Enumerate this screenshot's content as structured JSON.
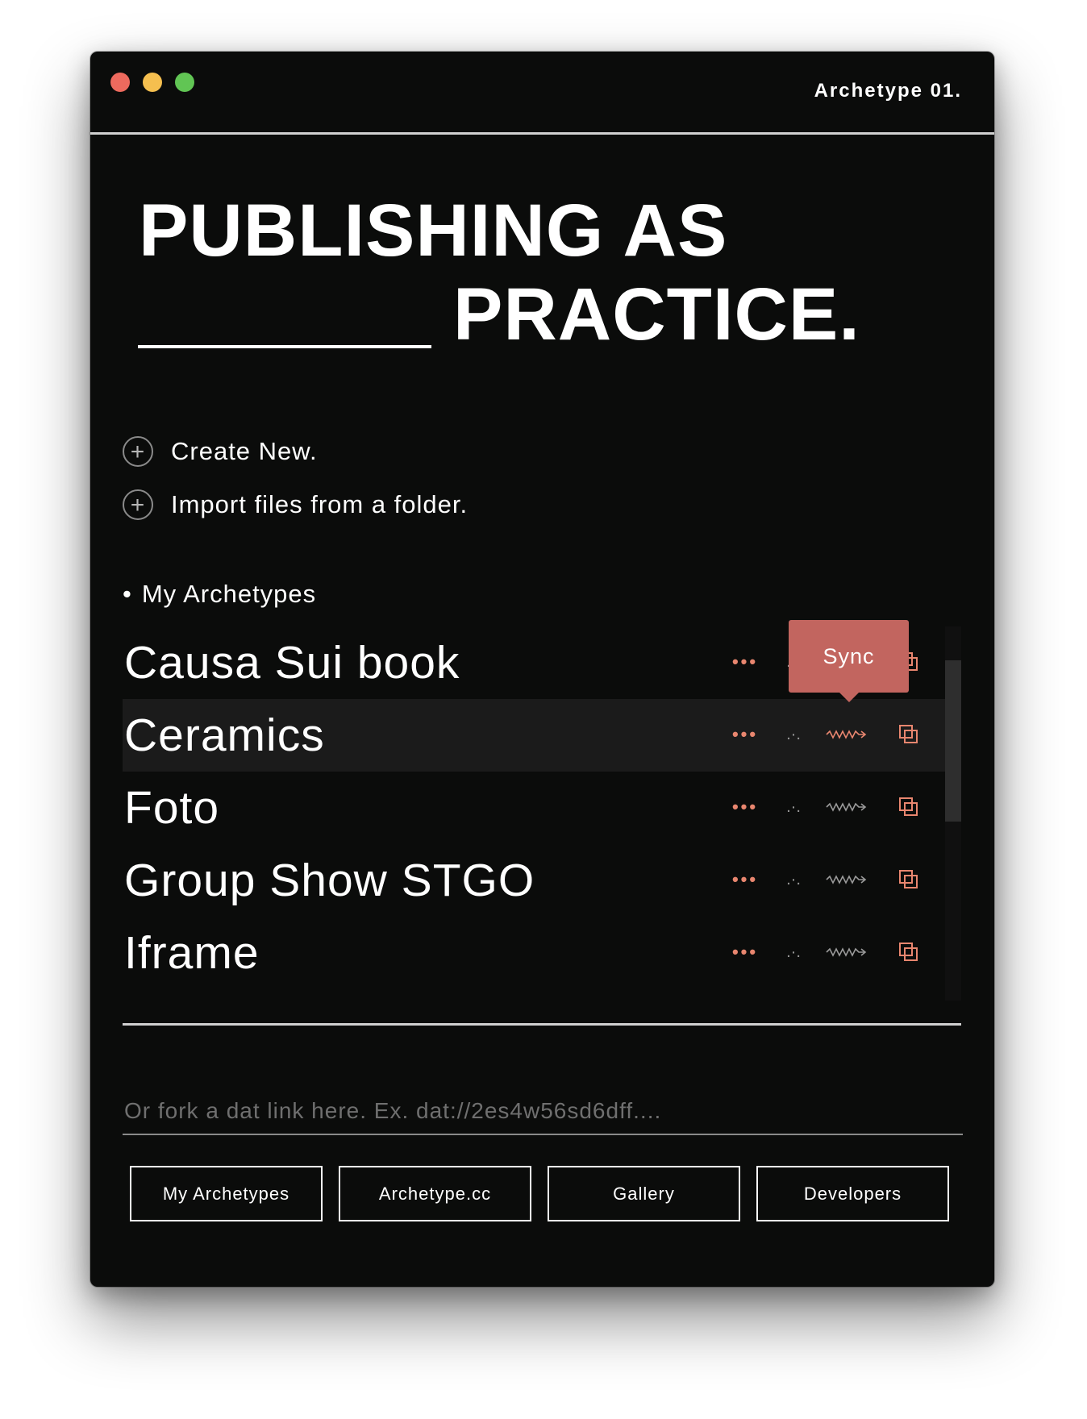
{
  "window": {
    "title": "Archetype 01."
  },
  "headline": {
    "line1": "PUBLISHING AS",
    "line2": "PRACTICE."
  },
  "actions": [
    {
      "label": "Create New."
    },
    {
      "label": "Import files from a folder."
    }
  ],
  "section": {
    "bullet": "•",
    "label": "My Archetypes"
  },
  "archetypes": [
    {
      "name": "Causa Sui book"
    },
    {
      "name": "Ceramics"
    },
    {
      "name": "Foto"
    },
    {
      "name": "Group Show STGO"
    },
    {
      "name": "Iframe"
    }
  ],
  "row_icons": {
    "menu": "ellipsis-icon",
    "peers": "peers-icon",
    "sync": "sync-wave-arrow-icon",
    "fork": "copy-icon",
    "menu_glyph": "•••",
    "peers_glyph": ".·."
  },
  "tooltip": {
    "label": "Sync",
    "active_row": 1
  },
  "fork": {
    "placeholder": "Or fork a dat link here. Ex. dat://2es4w56sd6dff...."
  },
  "footer": {
    "buttons": [
      {
        "label": "My Archetypes"
      },
      {
        "label": "Archetype.cc"
      },
      {
        "label": "Gallery"
      },
      {
        "label": "Developers"
      }
    ]
  },
  "colors": {
    "accent": "#e8866f",
    "tooltip": "#c2655f",
    "background": "#0b0c0b",
    "active_row": "#1b1b1b"
  }
}
